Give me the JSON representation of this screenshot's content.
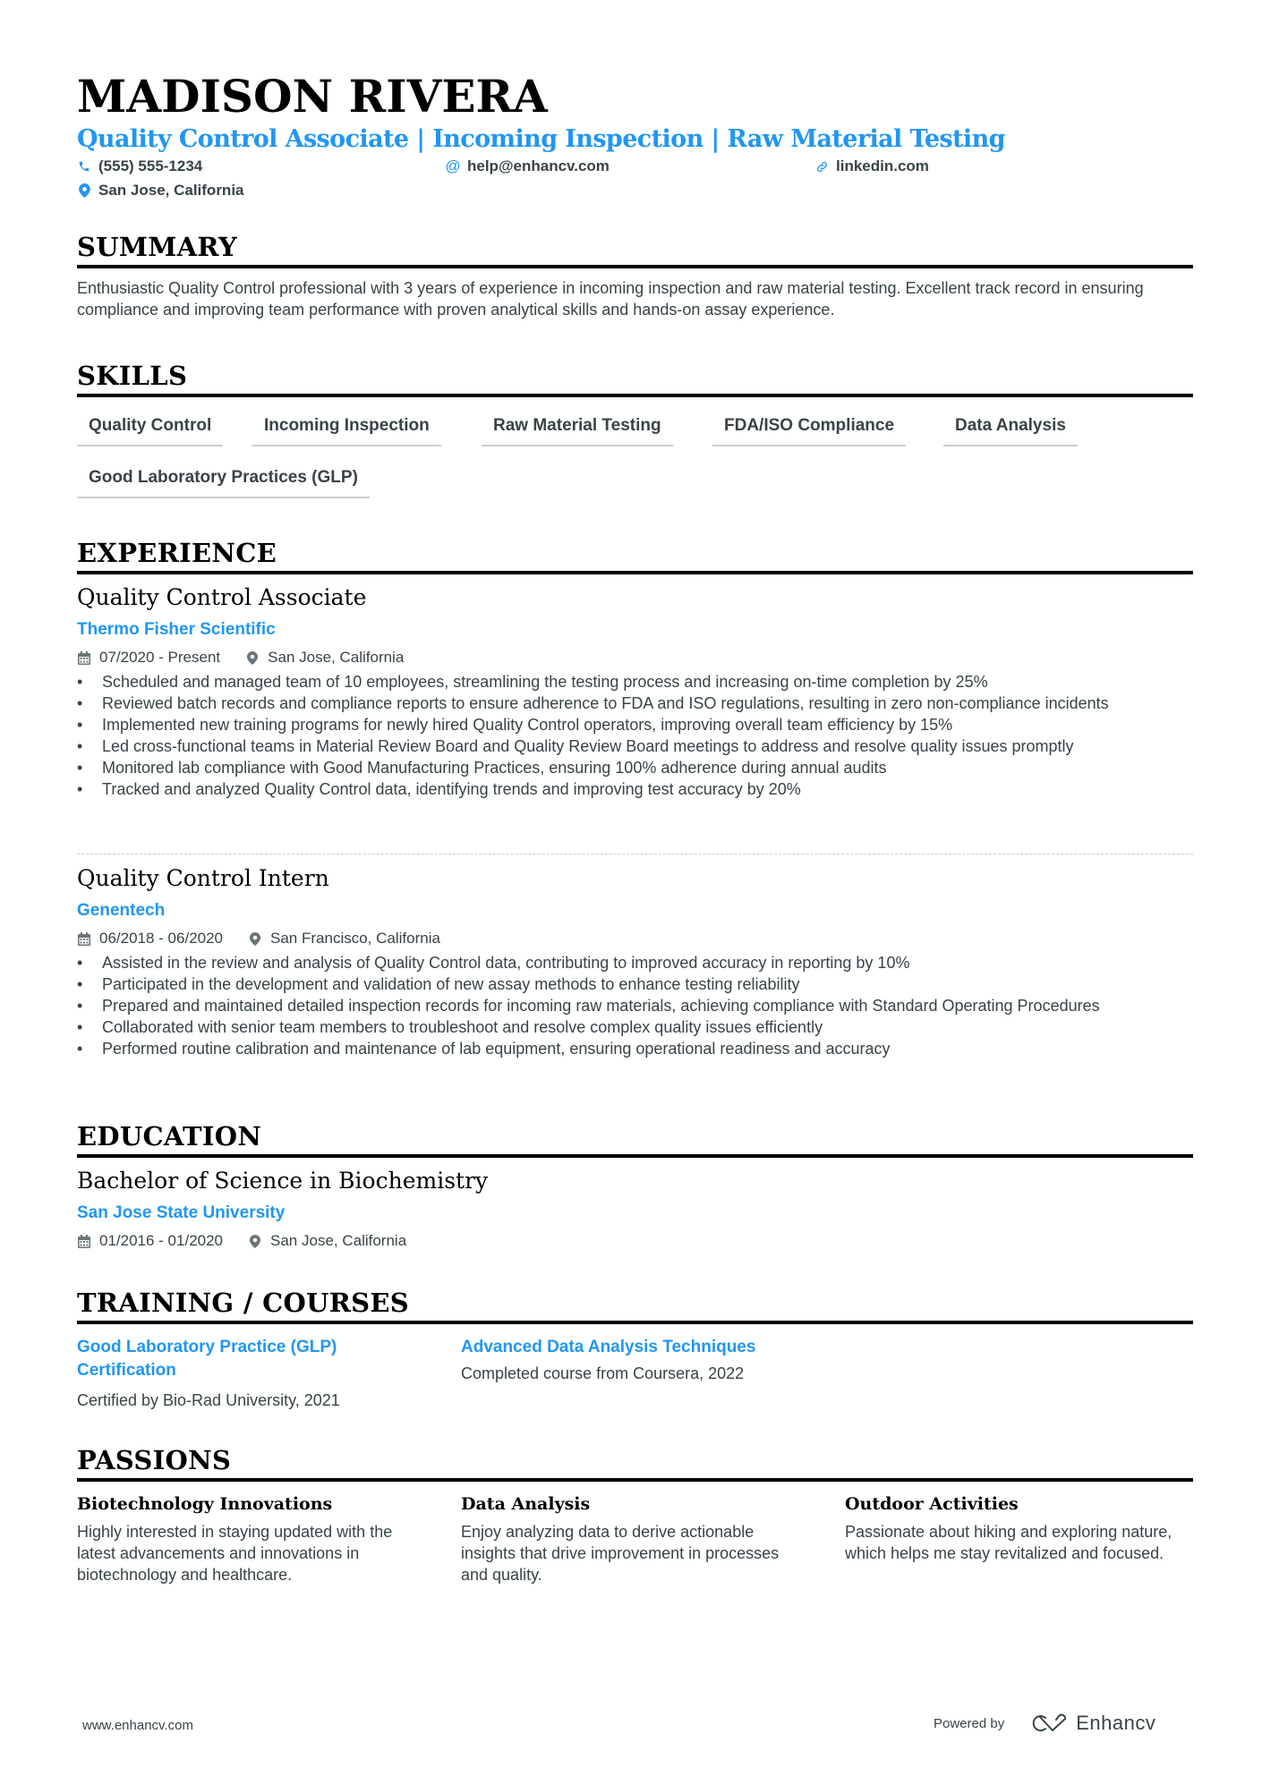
{
  "header": {
    "name": "MADISON RIVERA",
    "headline": "Quality Control Associate | Incoming Inspection | Raw Material Testing",
    "contacts": {
      "phone": {
        "icon": "phone-icon",
        "text": "(555) 555-1234"
      },
      "email": {
        "icon": "at-icon",
        "text": "help@enhancv.com"
      },
      "link": {
        "icon": "link-icon",
        "text": "linkedin.com"
      },
      "location": {
        "icon": "map-pin-icon",
        "text": "San Jose, California"
      }
    }
  },
  "summary": {
    "title": "SUMMARY",
    "text": "Enthusiastic Quality Control professional with 3 years of experience in incoming inspection and raw material testing. Excellent track record in ensuring compliance and improving team performance with proven analytical skills and hands-on assay experience."
  },
  "skills": {
    "title": "SKILLS",
    "items": [
      "Quality Control",
      "Incoming Inspection",
      "Raw Material Testing",
      "FDA/ISO Compliance",
      "Data Analysis",
      "Good Laboratory Practices (GLP)"
    ]
  },
  "experience": {
    "title": "EXPERIENCE",
    "jobs": [
      {
        "title": "Quality Control Associate",
        "company": "Thermo Fisher Scientific",
        "dates": "07/2020 - Present",
        "location": "San Jose, California",
        "bullets": [
          "Scheduled and managed team of 10 employees, streamlining the testing process and increasing on-time completion by 25%",
          "Reviewed batch records and compliance reports to ensure adherence to FDA and ISO regulations, resulting in zero non-compliance incidents",
          "Implemented new training programs for newly hired Quality Control operators, improving overall team efficiency by 15%",
          "Led cross-functional teams in Material Review Board and Quality Review Board meetings to address and resolve quality issues promptly",
          "Monitored lab compliance with Good Manufacturing Practices, ensuring 100% adherence during annual audits",
          "Tracked and analyzed Quality Control data, identifying trends and improving test accuracy by 20%"
        ]
      },
      {
        "title": "Quality Control Intern",
        "company": "Genentech",
        "dates": "06/2018 - 06/2020",
        "location": "San Francisco, California",
        "bullets": [
          "Assisted in the review and analysis of Quality Control data, contributing to improved accuracy in reporting by 10%",
          "Participated in the development and validation of new assay methods to enhance testing reliability",
          "Prepared and maintained detailed inspection records for incoming raw materials, achieving compliance with Standard Operating Procedures",
          "Collaborated with senior team members to troubleshoot and resolve complex quality issues efficiently",
          "Performed routine calibration and maintenance of lab equipment, ensuring operational readiness and accuracy"
        ]
      }
    ]
  },
  "education": {
    "title": "EDUCATION",
    "degree": "Bachelor of Science in Biochemistry",
    "school": "San Jose State University",
    "dates": "01/2016 - 01/2020",
    "location": "San Jose, California"
  },
  "training": {
    "title": "TRAINING / COURSES",
    "items": [
      {
        "title": "Good Laboratory Practice (GLP) Certification",
        "description": "Certified by Bio-Rad University, 2021"
      },
      {
        "title": "Advanced Data Analysis Techniques",
        "description": "Completed course from Coursera, 2022"
      }
    ]
  },
  "passions": {
    "title": "PASSIONS",
    "items": [
      {
        "title": "Biotechnology Innovations",
        "description": "Highly interested in staying updated with the latest advancements and innovations in biotechnology and healthcare."
      },
      {
        "title": "Data Analysis",
        "description": "Enjoy analyzing data to derive actionable insights that drive improvement in processes and quality."
      },
      {
        "title": "Outdoor Activities",
        "description": "Passionate about hiking and exploring nature, which helps me stay revitalized and focused."
      }
    ]
  },
  "footer": {
    "website": "www.enhancv.com",
    "powered_by": "Powered by",
    "brand": "Enhancv"
  },
  "colors": {
    "accent": "#2196f3",
    "text": "#384347",
    "heading": "#000000"
  }
}
